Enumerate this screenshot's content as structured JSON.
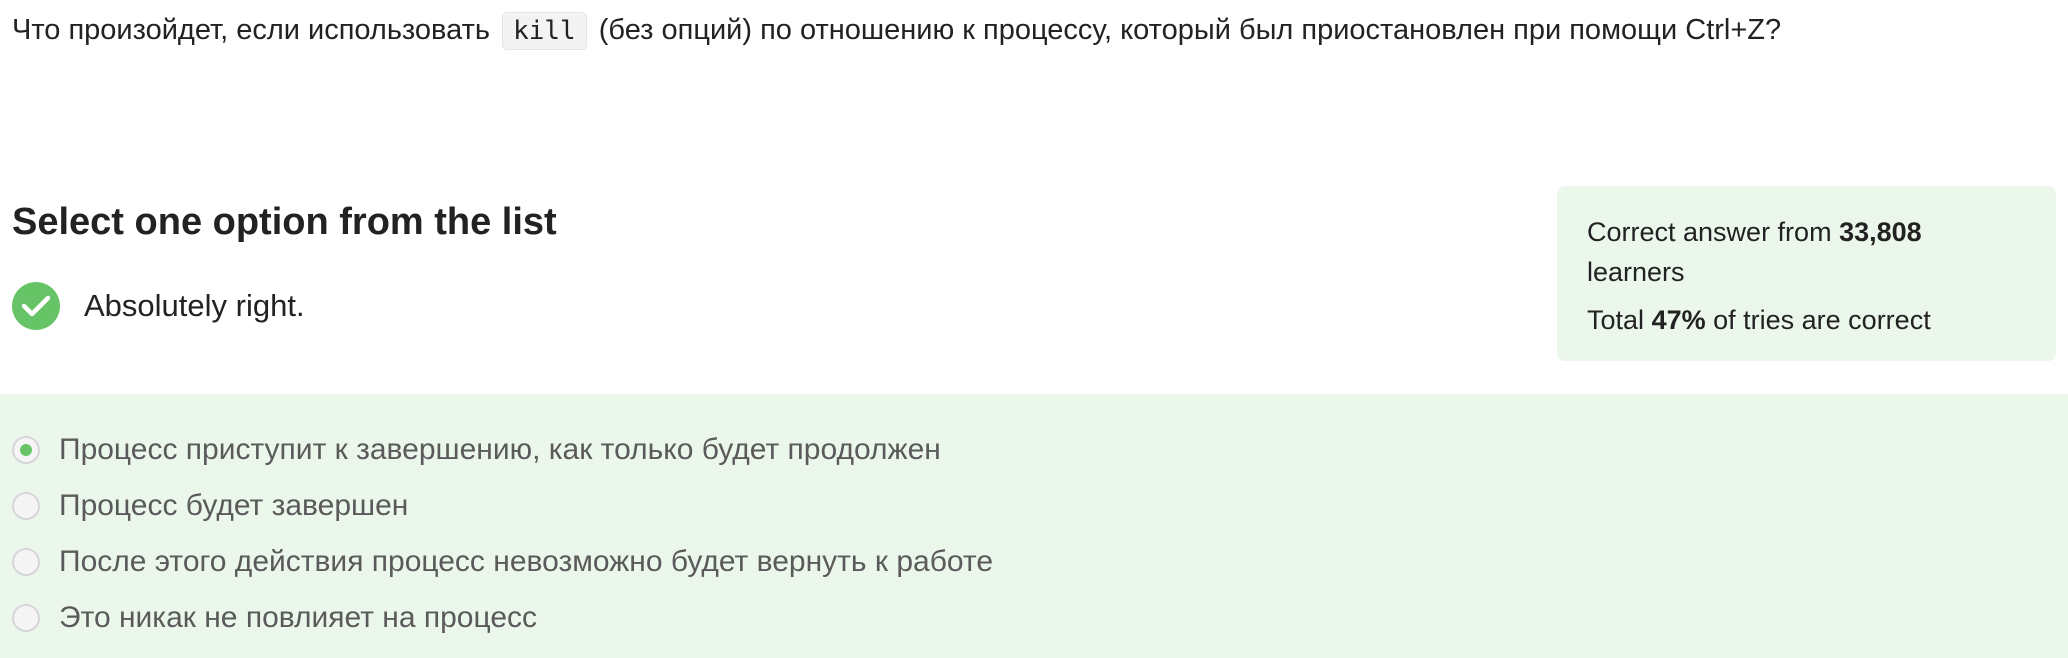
{
  "question": {
    "text_before": "Что произойдет, если использовать",
    "code": "kill",
    "text_after": "(без опций) по отношению к процессу, который был приостановлен при помощи Ctrl+Z?"
  },
  "quiz": {
    "instruction": "Select one option from the list",
    "feedback_icon": "check-icon",
    "feedback_text": "Absolutely right.",
    "accent_color": "#66c467",
    "panel_color": "#ecf7eb"
  },
  "stats": {
    "correct_prefix": "Correct answer from",
    "learners_count": "33,808",
    "learners_suffix": "learners",
    "total_prefix": "Total",
    "percent_correct": "47%",
    "total_suffix": "of tries are correct"
  },
  "options": [
    {
      "label": "Процесс приступит к завершению, как только будет продолжен",
      "selected": true
    },
    {
      "label": "Процесс будет завершен",
      "selected": false
    },
    {
      "label": "После этого действия процесс невозможно будет вернуть к работе",
      "selected": false
    },
    {
      "label": "Это никак не повлияет на процесс",
      "selected": false
    }
  ]
}
